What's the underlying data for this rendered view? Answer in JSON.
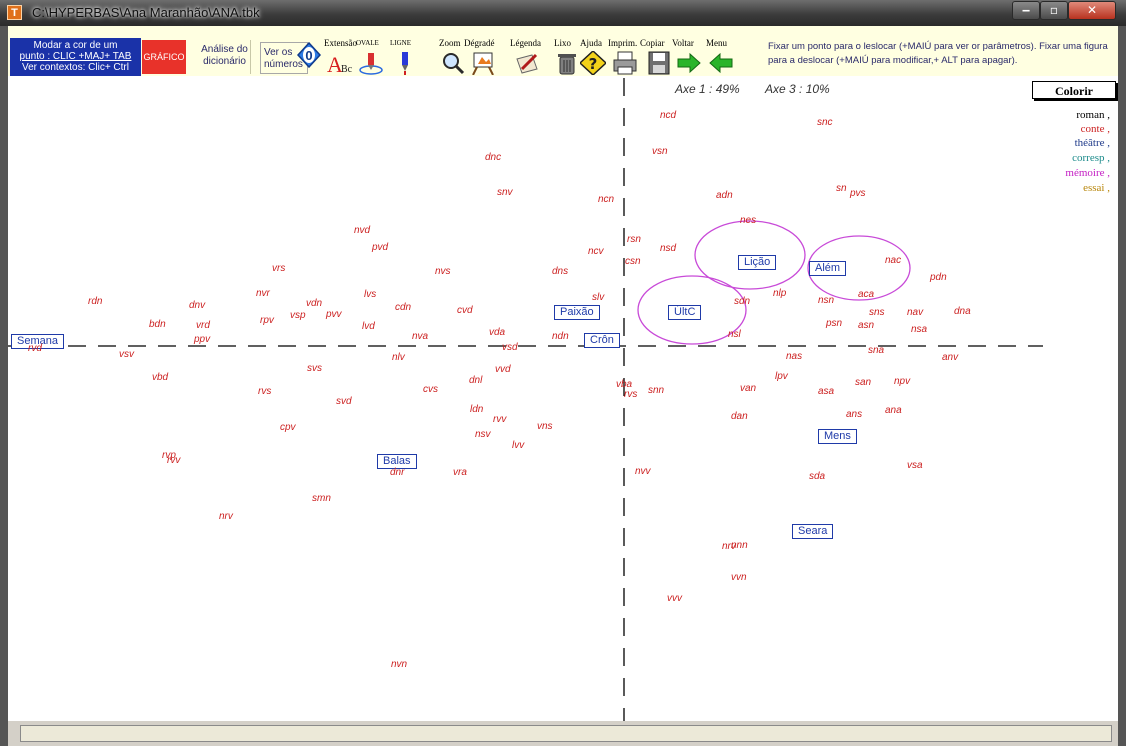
{
  "window": {
    "title": "C:\\HYPERBAS\\Ana Maranhão\\ANA.tbk",
    "app_icon": "T"
  },
  "toolbar": {
    "modar_lines": [
      "Modar a cor de um",
      "punto : CLIC +MAJ+ TAB",
      "Ver contextos: Clic+ Ctrl"
    ],
    "grafico": "GRÁFICO",
    "analise_lines": [
      "Análise do",
      "dicionário"
    ],
    "veros_lines": [
      "Ver os",
      "números"
    ],
    "zero": "0",
    "tools": [
      {
        "label": "Extensão",
        "icon": "text-size-icon"
      },
      {
        "label": "OVALE",
        "icon": "oval-pen-icon"
      },
      {
        "label": "LIGNE",
        "icon": "line-pen-icon"
      },
      {
        "label": "Zoom",
        "icon": "magnifier-icon"
      },
      {
        "label": "Dégradé",
        "icon": "easel-icon"
      },
      {
        "label": "Légenda",
        "icon": "pen-paper-icon"
      },
      {
        "label": "Lixo",
        "icon": "trash-icon"
      },
      {
        "label": "Ajuda",
        "icon": "help-icon"
      },
      {
        "label": "Imprim.",
        "icon": "printer-icon"
      },
      {
        "label": "Copiar",
        "icon": "floppy-icon"
      },
      {
        "label": "Voltar",
        "icon": "arrow-right-icon"
      },
      {
        "label": "Menu",
        "icon": "arrow-left-icon"
      }
    ],
    "help_text": "Fixar um ponto para o leslocar (+MAIÚ para ver or parâmetros). Fixar uma figura para a deslocar (+MAIÚ para modificar,+ ALT para apagar)."
  },
  "plot": {
    "axis1": "Axe 1 :  49%",
    "axis3": "Axe 3 :  10%",
    "colorir": "Colorir",
    "legend": [
      {
        "text": "roman ,",
        "color": "#000000"
      },
      {
        "text": "conte ,",
        "color": "#cc2222"
      },
      {
        "text": "théâtre ,",
        "color": "#1f3a8a"
      },
      {
        "text": "corresp ,",
        "color": "#1a8a8a"
      },
      {
        "text": "mémoire ,",
        "color": "#c41ec4"
      },
      {
        "text": "essai ,",
        "color": "#b8860b"
      }
    ],
    "boxes": [
      "Semana",
      "Paixão",
      "Crôn",
      "ÚltC",
      "Lição",
      "Além",
      "Mens",
      "Balas",
      "Seara"
    ],
    "points": [
      "ncd",
      "snc",
      "vsn",
      "dnc",
      "snv",
      "ncn",
      "adn",
      "sn",
      "pvs",
      "nvd",
      "pvd",
      "nes",
      "rsn",
      "nsd",
      "csn",
      "ncv",
      "nac",
      "pdn",
      "vrs",
      "nvs",
      "dns",
      "slv",
      "nlp",
      "nsn",
      "aca",
      "rdn",
      "nvr",
      "lvs",
      "vdn",
      "dnv",
      "cdn",
      "cvd",
      "vsp",
      "pvv",
      "rpv",
      "sdn",
      "sns",
      "nav",
      "dna",
      "bdn",
      "vrd",
      "lvd",
      "vda",
      "ndn",
      "psn",
      "asn",
      "nsa",
      "nsl",
      "ppv",
      "nva",
      "vsd",
      "nas",
      "sna",
      "anv",
      "rvd",
      "vsv",
      "nlv",
      "svs",
      "vvd",
      "dnl",
      "lpv",
      "vba",
      "rvs",
      "snn",
      "san",
      "npv",
      "vbd",
      "rvs",
      "cvs",
      "svd",
      "van",
      "asa",
      "ldn",
      "rvv",
      "vns",
      "dan",
      "ans",
      "ana",
      "cpv",
      "nsv",
      "lvv",
      "rvp",
      "rvv",
      "dnr",
      "vra",
      "nvv",
      "vsa",
      "sda",
      "smn",
      "nrv",
      "nnn",
      "nrv",
      "vvn",
      "vvv",
      "nvn"
    ]
  }
}
